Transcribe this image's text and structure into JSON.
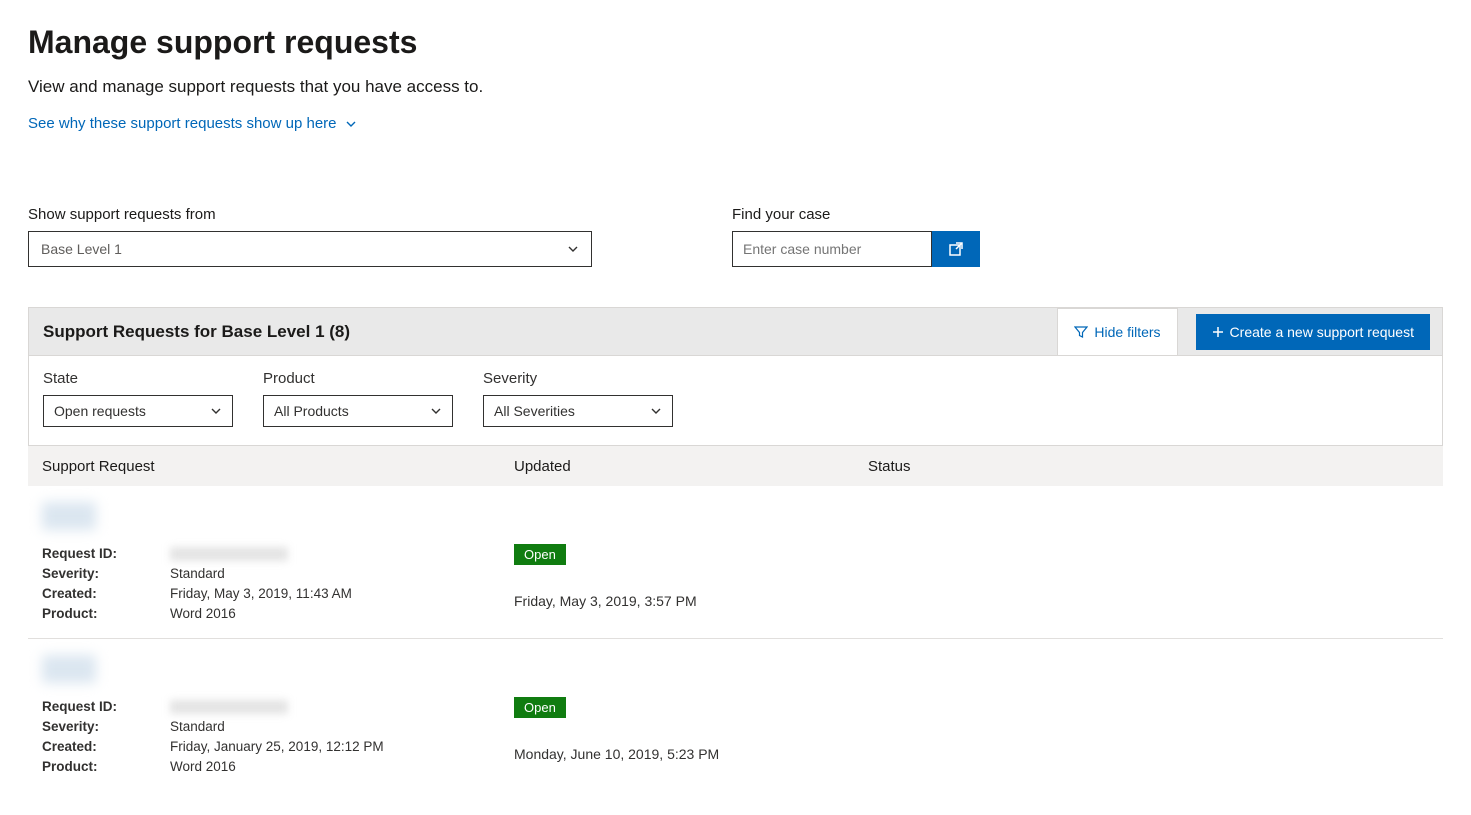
{
  "header": {
    "title": "Manage support requests",
    "subtitle": "View and manage support requests that you have access to.",
    "why_link": "See why these support requests show up here"
  },
  "controls": {
    "show_from_label": "Show support requests from",
    "show_from_value": "Base Level 1",
    "find_label": "Find your case",
    "find_placeholder": "Enter case number"
  },
  "panel": {
    "title": "Support Requests for Base Level 1 (8)",
    "hide_filters": "Hide filters",
    "create_btn": "Create a new support request"
  },
  "filters": {
    "state_label": "State",
    "state_value": "Open requests",
    "product_label": "Product",
    "product_value": "All Products",
    "severity_label": "Severity",
    "severity_value": "All Severities"
  },
  "columns": {
    "request": "Support Request",
    "updated": "Updated",
    "status": "Status"
  },
  "labels": {
    "request_id": "Request ID:",
    "severity": "Severity:",
    "created": "Created:",
    "product": "Product:"
  },
  "rows": [
    {
      "severity": "Standard",
      "created": "Friday, May 3, 2019, 11:43 AM",
      "product": "Word 2016",
      "status_pill": "Open",
      "updated": "Friday, May 3, 2019, 3:57 PM"
    },
    {
      "severity": "Standard",
      "created": "Friday, January 25, 2019, 12:12 PM",
      "product": "Word 2016",
      "status_pill": "Open",
      "updated": "Monday, June 10, 2019, 5:23 PM"
    }
  ]
}
